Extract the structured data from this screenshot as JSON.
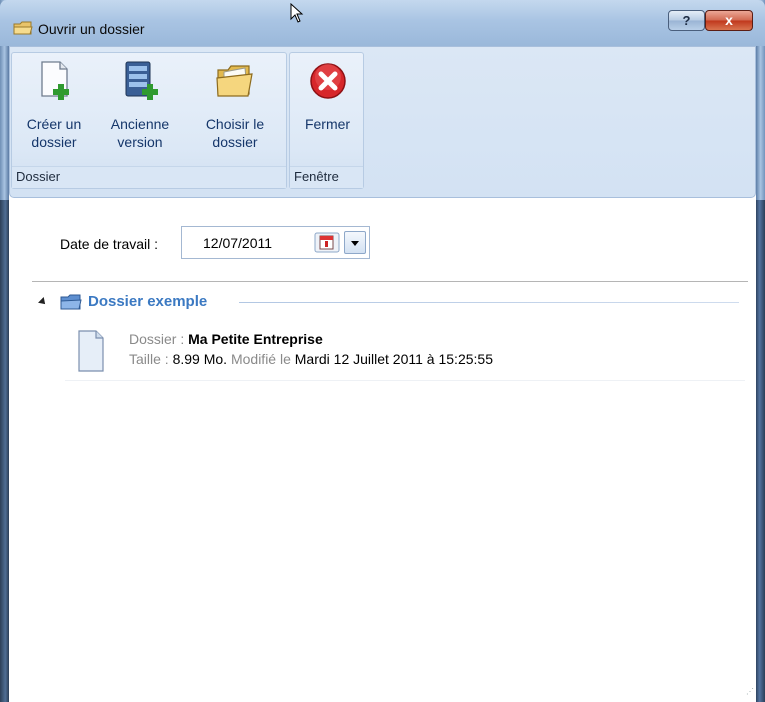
{
  "window": {
    "title": "Ouvrir un dossier",
    "help_label": "?",
    "close_label": "x"
  },
  "ribbon": {
    "groups": [
      {
        "caption": "Dossier",
        "buttons": [
          {
            "line1": "Créer un",
            "line2": "dossier",
            "icon": "new-document-plus-icon"
          },
          {
            "line1": "Ancienne",
            "line2": "version",
            "icon": "database-server-plus-icon"
          },
          {
            "line1": "Choisir le",
            "line2": "dossier",
            "icon": "open-folder-icon"
          }
        ]
      },
      {
        "caption": "Fenêtre",
        "buttons": [
          {
            "line1": "Fermer",
            "line2": "",
            "icon": "red-close-circle-icon"
          }
        ]
      }
    ]
  },
  "work_date": {
    "label": "Date de travail :",
    "value": "12/07/2011"
  },
  "file_group": {
    "title": "Dossier exemple",
    "expanded": true,
    "items": [
      {
        "dossier_label": "Dossier :",
        "dossier_name": "Ma Petite Entreprise",
        "size_label": "Taille :",
        "size_value": "8.99 Mo.",
        "modified_label": "Modifié le",
        "modified_value": "Mardi 12 Juillet 2011 à 15:25:55"
      }
    ]
  },
  "colors": {
    "group_title": "#3b79c2",
    "ribbon_label": "#15366a",
    "muted_text": "#8a8a8a"
  }
}
